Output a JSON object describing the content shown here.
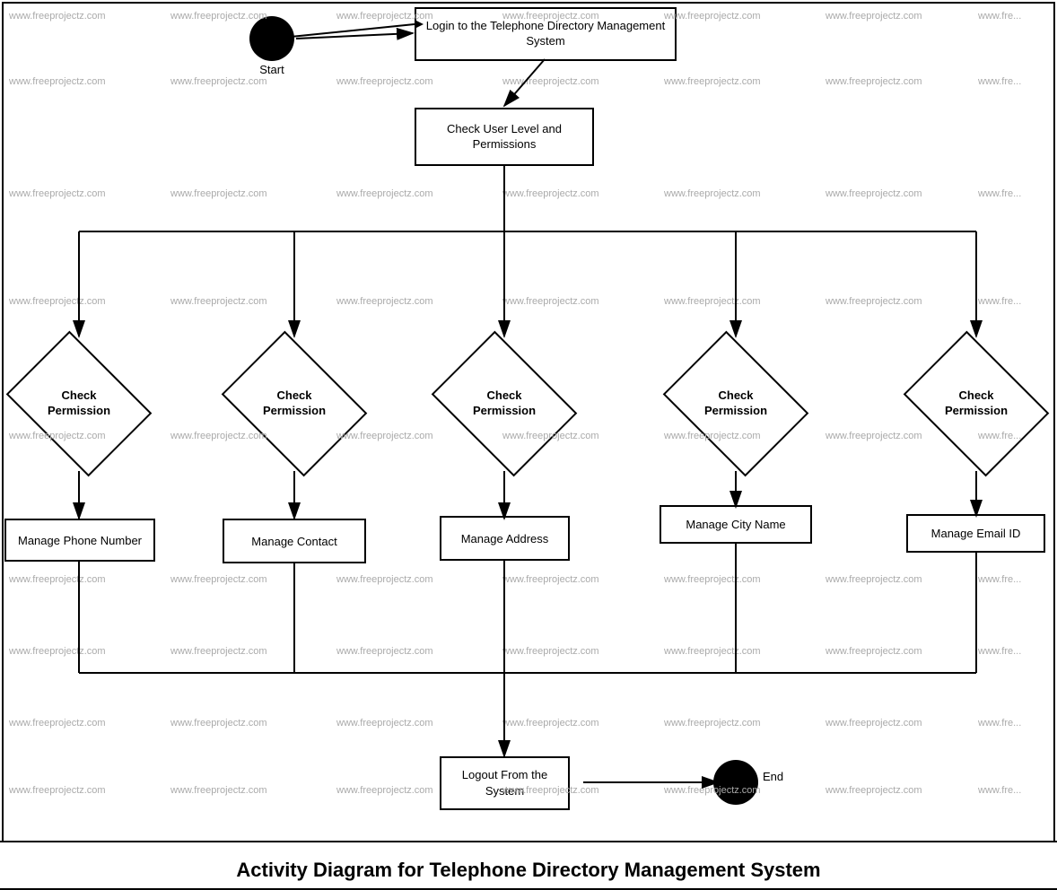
{
  "diagram": {
    "title": "Activity Diagram for Telephone Directory Management System",
    "watermark": "www.freeprojectz.com",
    "nodes": {
      "start_label": "Start",
      "end_label": "End",
      "login_box": "Login to the Telephone Directory Management System",
      "check_permissions_box": "Check User Level and Permissions",
      "diamond1": "Check\nPermission",
      "diamond2": "Check\nPermission",
      "diamond3": "Check\nPermission",
      "diamond4": "Check\nPermission",
      "diamond5": "Check\nPermission",
      "manage_phone": "Manage Phone Number",
      "manage_contact": "Manage Contact",
      "manage_address": "Manage Address",
      "manage_city": "Manage City Name",
      "manage_email": "Manage Email ID",
      "logout_box": "Logout From the System"
    }
  }
}
